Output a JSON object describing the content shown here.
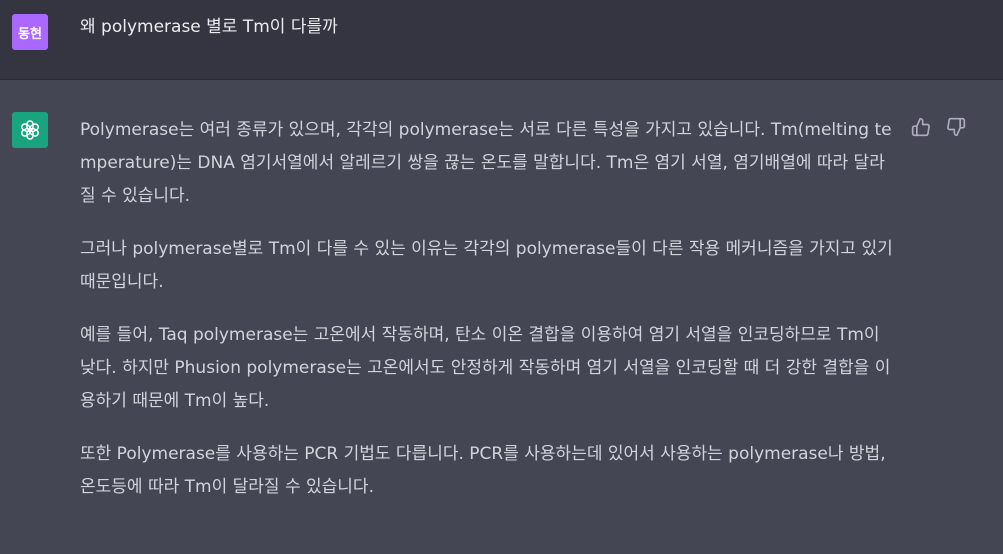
{
  "user": {
    "avatar_text": "동현",
    "avatar_color": "#ab68ff",
    "message": "왜 polymerase 별로 Tm이 다를까"
  },
  "assistant": {
    "avatar_icon": "openai-logo-icon",
    "avatar_color": "#19a37f",
    "paragraphs": [
      "Polymerase는 여러 종류가 있으며, 각각의 polymerase는 서로 다른 특성을 가지고 있습니다. Tm(melting temperature)는 DNA 염기서열에서 알레르기 쌍을 끊는 온도를 말합니다. Tm은 염기 서열, 염기배열에 따라 달라질 수 있습니다.",
      "그러나 polymerase별로 Tm이 다를 수 있는 이유는 각각의 polymerase들이 다른 작용 메커니즘을 가지고 있기 때문입니다.",
      "예를 들어, Taq polymerase는 고온에서 작동하며, 탄소 이온 결합을 이용하여 염기 서열을 인코딩하므로 Tm이 낮다. 하지만 Phusion polymerase는 고온에서도 안정하게 작동하며 염기 서열을 인코딩할 때 더 강한 결합을 이용하기 때문에 Tm이 높다.",
      "또한 Polymerase를 사용하는 PCR 기법도 다릅니다. PCR를 사용하는데 있어서 사용하는 polymerase나 방법, 온도등에 따라 Tm이 달라질 수 있습니다."
    ]
  },
  "feedback": {
    "thumbs_up_icon": "thumbs-up-icon",
    "thumbs_down_icon": "thumbs-down-icon"
  },
  "colors": {
    "user_background": "#343541",
    "assistant_background": "#444654",
    "text": "#d1d5db"
  }
}
